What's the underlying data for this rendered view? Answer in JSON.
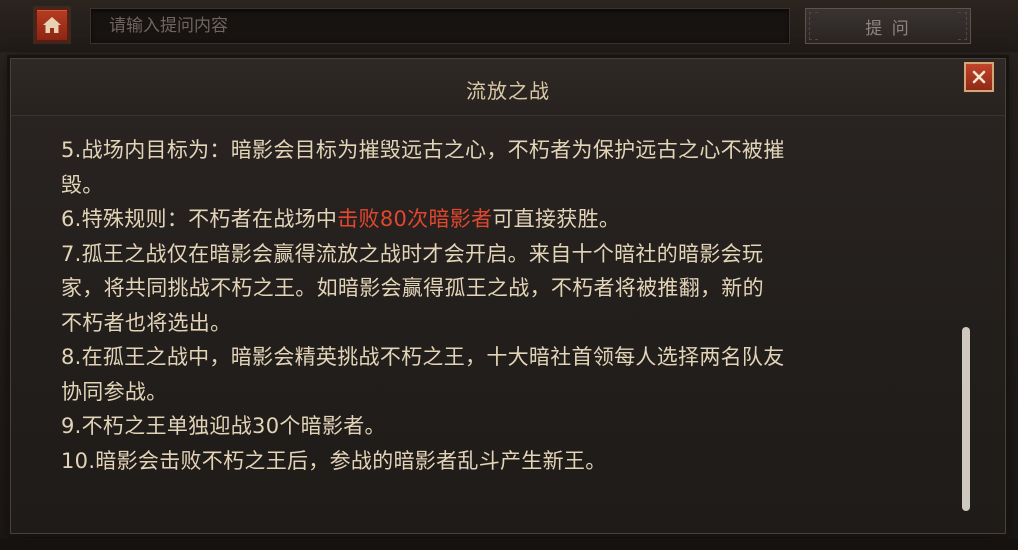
{
  "topbar": {
    "home_icon": "home-icon",
    "search_placeholder": "请输入提问内容",
    "search_value": "",
    "ask_label": "提 问"
  },
  "dialog": {
    "title": "流放之战",
    "close_icon": "close-icon",
    "lines": [
      "5.战场内目标为：暗影会目标为摧毁远古之心，不朽者为保护远古之心不被摧",
      "毁。",
      "7.孤王之战仅在暗影会赢得流放之战时才会开启。来自十个暗社的暗影会玩",
      "家，将共同挑战不朽之王。如暗影会赢得孤王之战，不朽者将被推翻，新的",
      "不朽者也将选出。",
      "8.在孤王之战中，暗影会精英挑战不朽之王，十大暗社首领每人选择两名队友",
      "协同参战。",
      "9.不朽之王单独迎战30个暗影者。",
      "10.暗影会击败不朽之王后，参战的暗影者乱斗产生新王。"
    ],
    "rule6": {
      "prefix": "6.特殊规则：不朽者在战场中",
      "highlight": "击败80次暗影者",
      "suffix": "可直接获胜。"
    }
  },
  "colors": {
    "text": "#e3d4b8",
    "highlight": "#e0472f",
    "accent": "#b63b22"
  }
}
